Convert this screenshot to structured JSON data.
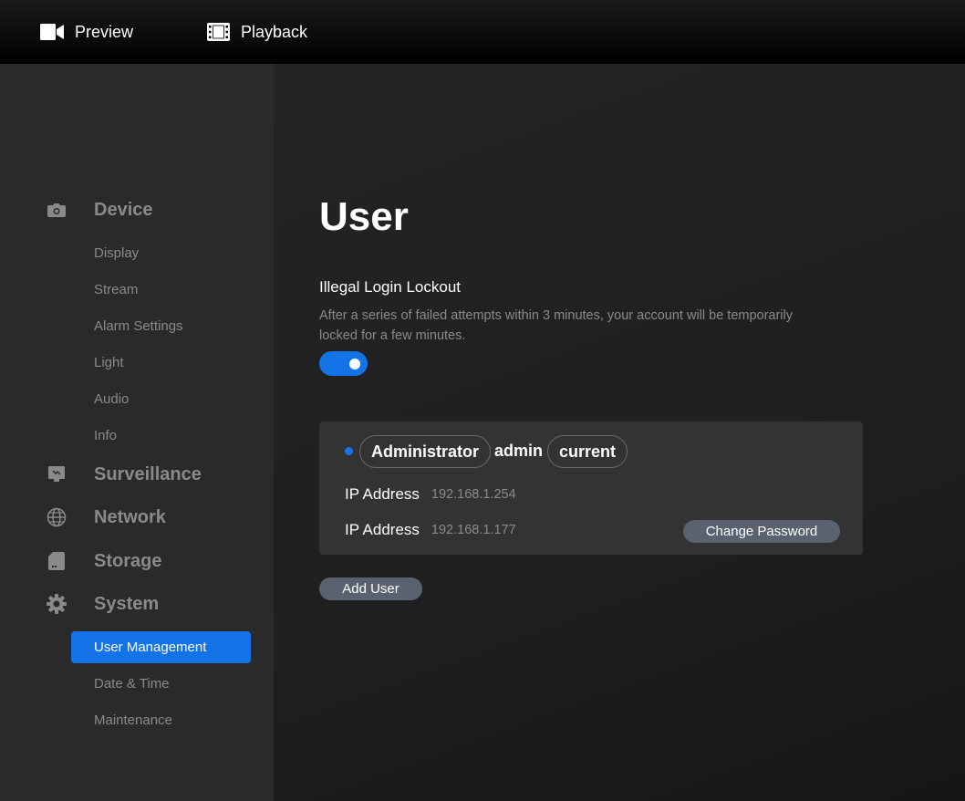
{
  "topbar": {
    "preview": {
      "label": "Preview",
      "icon": "video-camera-icon"
    },
    "playback": {
      "label": "Playback",
      "icon": "film-icon"
    }
  },
  "sidebar": {
    "sections": [
      {
        "label": "Device",
        "icon": "camera-icon",
        "items": [
          "Display",
          "Stream",
          "Alarm Settings",
          "Light",
          "Audio",
          "Info"
        ]
      },
      {
        "label": "Surveillance",
        "icon": "monitor-icon",
        "items": []
      },
      {
        "label": "Network",
        "icon": "globe-icon",
        "items": []
      },
      {
        "label": "Storage",
        "icon": "sd-card-icon",
        "items": []
      },
      {
        "label": "System",
        "icon": "gear-icon",
        "items": [
          "User Management",
          "Date & Time",
          "Maintenance"
        ]
      }
    ],
    "active_item": "User Management"
  },
  "main": {
    "title": "User",
    "lockout": {
      "title": "Illegal Login Lockout",
      "description": "After a series of failed attempts within 3 minutes, your account will be temporarily locked for a few minutes.",
      "enabled": true
    },
    "user_card": {
      "role": "Administrator",
      "username": "admin",
      "status": "current",
      "ip_rows": [
        {
          "label": "IP Address",
          "value": "192.168.1.254"
        },
        {
          "label": "IP Address",
          "value": "192.168.1.177"
        }
      ],
      "change_password_label": "Change Password"
    },
    "add_user_label": "Add User"
  },
  "colors": {
    "accent": "#1473e6",
    "button": "#5a6270",
    "muted_text": "#8a8a8a"
  }
}
